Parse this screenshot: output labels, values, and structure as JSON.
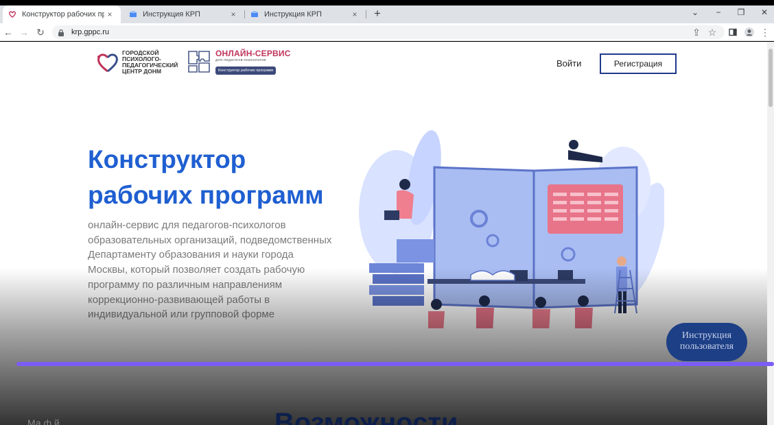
{
  "browser": {
    "tabs": [
      {
        "title": "Конструктор рабочих программ"
      },
      {
        "title": "Инструкция КРП"
      },
      {
        "title": "Инструкция КРП"
      }
    ],
    "new_tab": "+",
    "close": "×",
    "url": "krp.gppc.ru"
  },
  "header": {
    "org_logo_lines": [
      "ГОРОДСКОЙ",
      "ПСИХОЛОГО-",
      "ПЕДАГОГИЧЕСКИЙ",
      "ЦЕНТР ДОНМ"
    ],
    "service_brand": "ОНЛАЙН-СЕРВИС",
    "service_sub": "для педагогов-психологов",
    "service_pill": "Конструктор рабочих программ",
    "login": "Войти",
    "register": "Регистрация"
  },
  "hero": {
    "title_line1": "Конструктор",
    "title_line2": "рабочих программ",
    "description": "онлайн-сервис для педагогов-психологов образовательных организаций, подведомственных Департаменту образования и науки города Москвы, который позволяет создать рабочую программу по различным направлениям коррекционно-развивающей работы в индивидуальной или групповой форме"
  },
  "help_button": {
    "line1": "Инструкция",
    "line2": "пользователя"
  },
  "next_section": {
    "heading": "Возможности",
    "left_text": "Ма      ф                  й"
  },
  "colors": {
    "accent": "#1f5fd1",
    "brand": "#c0335a",
    "button_border": "#1e3a8a",
    "progress": "#7b5cf5"
  }
}
